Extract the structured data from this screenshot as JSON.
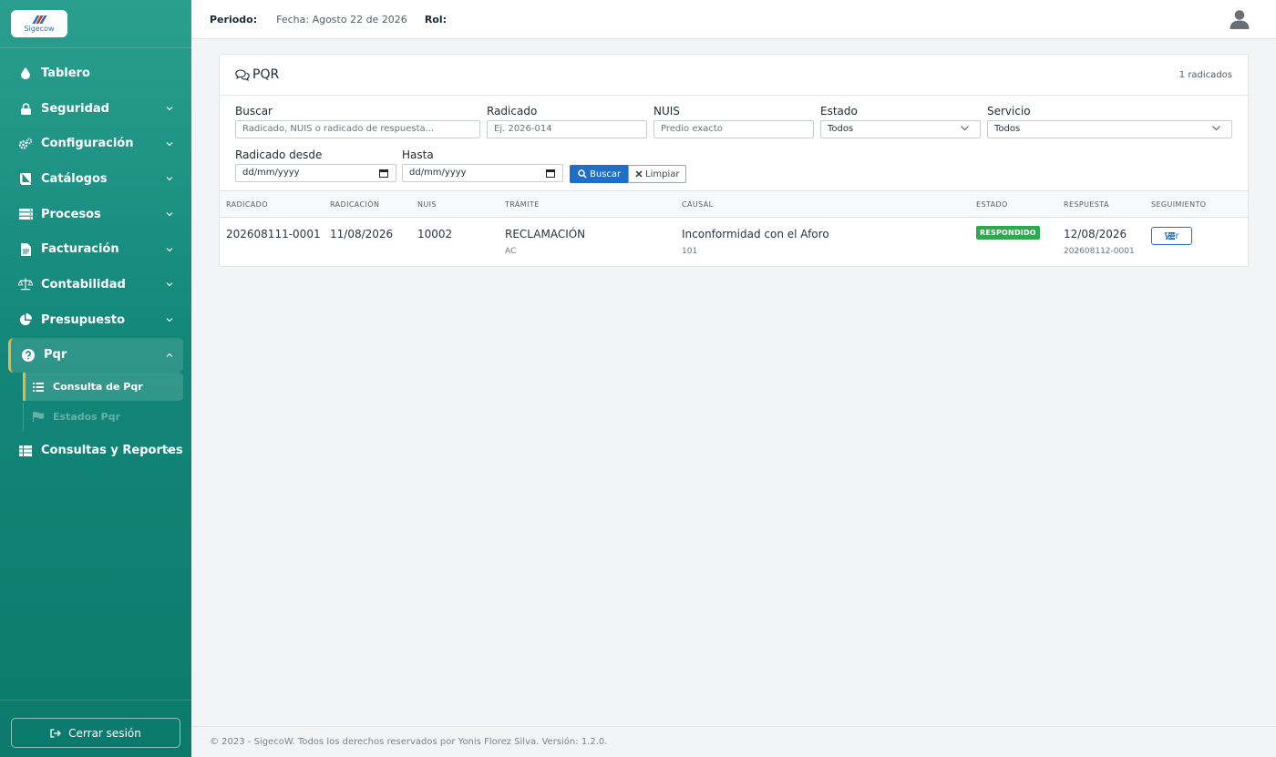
{
  "app": {
    "logo_text": "Sigecow"
  },
  "colors": {
    "sidebar": "#13877a",
    "accent": "#f0b43c",
    "primary": "#1f6fc9",
    "success": "#2fa84f"
  },
  "topbar": {
    "periodo_label": "Periodo:",
    "periodo_value": "Fecha: Agosto 22 de 2026",
    "rol_label": "Rol:"
  },
  "sidebar": {
    "items": [
      {
        "label": "Tablero",
        "icon": "drop-icon"
      },
      {
        "label": "Seguridad",
        "icon": "lock-icon"
      },
      {
        "label": "Configuración",
        "icon": "gears-icon"
      },
      {
        "label": "Catálogos",
        "icon": "book-icon"
      },
      {
        "label": "Procesos",
        "icon": "server-icon"
      },
      {
        "label": "Facturación",
        "icon": "file-icon"
      },
      {
        "label": "Contabilidad",
        "icon": "scale-icon"
      },
      {
        "label": "Presupuesto",
        "icon": "pie-icon"
      },
      {
        "label": "Pqr",
        "icon": "question-icon"
      },
      {
        "label": "Consultas y Reportes",
        "icon": "table-icon"
      }
    ],
    "pqr_sub": [
      {
        "label": "Consulta de Pqr"
      },
      {
        "label": "Estados Pqr"
      }
    ],
    "logout": "Cerrar sesión"
  },
  "card": {
    "title": "PQR",
    "count": "1 radicados"
  },
  "filters": {
    "buscar_label": "Buscar",
    "buscar_placeholder": "Radicado, NUIS o radicado de respuesta...",
    "radicado_label": "Radicado",
    "radicado_placeholder": "Ej. 2026-014",
    "nuis_label": "NUIS",
    "nuis_placeholder": "Predio exacto",
    "estado_label": "Estado",
    "estado_value": "Todos",
    "servicio_label": "Servicio",
    "servicio_value": "Todos",
    "desde_label": "Radicado desde",
    "desde_value": "dd/mm/yyyy",
    "hasta_label": "Hasta",
    "hasta_value": "dd/mm/yyyy",
    "buscar_btn": "Buscar",
    "limpiar_btn": "Limpiar"
  },
  "table": {
    "headers": [
      "RADICADO",
      "RADICACIÓN",
      "NUIS",
      "TRÁMITE",
      "CAUSAL",
      "ESTADO",
      "RESPUESTA",
      "SEGUIMIENTO"
    ],
    "rows": [
      {
        "radicado": "202608111-0001",
        "radicacion": "11/08/2026",
        "nuis": "10002",
        "tramite": "RECLAMACIÓN",
        "tramite_sub": "AC",
        "causal": "Inconformidad con el Aforo",
        "causal_sub": "101",
        "estado": "RESPONDIDO",
        "respuesta": "12/08/2026",
        "respuesta_sub": "202608112-0001",
        "accion": "Ver"
      }
    ]
  },
  "footer": {
    "text": "© 2023 - SigecoW. Todos los derechos reservados por Yonis Florez Silva. Versión: 1.2.0."
  }
}
